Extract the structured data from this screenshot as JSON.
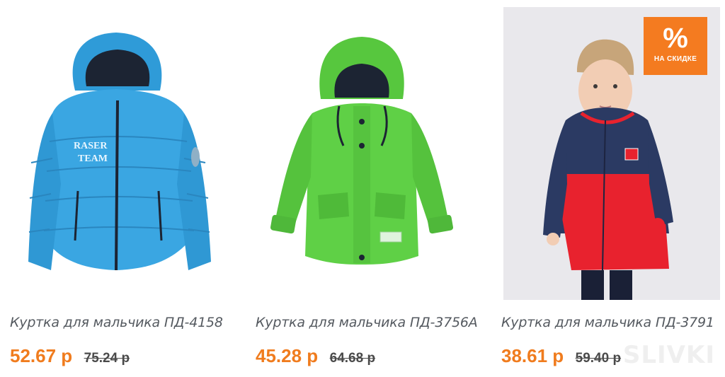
{
  "products": [
    {
      "title": "Куртка для мальчика ПД-4158",
      "price": "52.67 р",
      "old_price": "75.24 р",
      "print_text": [
        "RASER",
        "TEAM"
      ],
      "color": "#3aa6e2"
    },
    {
      "title": "Куртка для мальчика ПД-3756А",
      "price": "45.28 р",
      "old_price": "64.68 р",
      "color": "#5fd046"
    },
    {
      "title": "Куртка для мальчика ПД-3791",
      "price": "38.61 р",
      "old_price": "59.40 р",
      "badge": {
        "symbol": "%",
        "text": "НА СКИДКЕ"
      },
      "color": "#e8222e"
    }
  ],
  "colors": {
    "accent": "#f07c1e",
    "badge": "#f47b20"
  },
  "watermark": "SLIVKI"
}
